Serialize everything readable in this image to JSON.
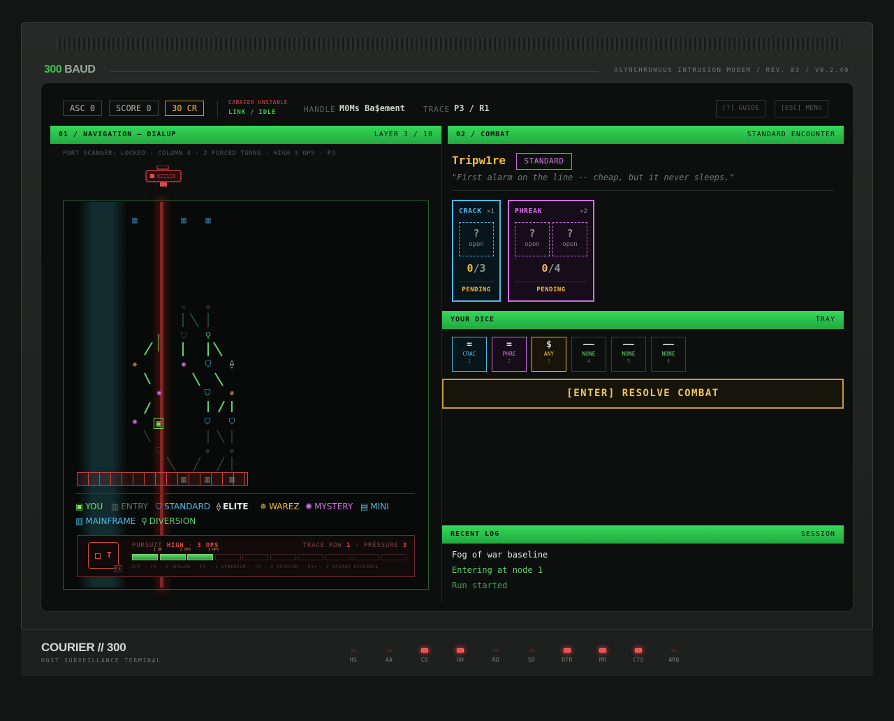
{
  "device": {
    "brand_num": "300",
    "brand_word": "BAUD",
    "subtitle": "ASYNCHRONOUS INTRUSION MODEM / REV. 03 / V0.2.40",
    "bottom_brand": "COURIER // 300",
    "bottom_sub": "HOST SURVEILLANCE TERMINAL"
  },
  "topbar": {
    "asc": "ASC 0",
    "score": "SCORE 0",
    "credits": "30 CR",
    "carrier": "CARRIER UNSTABLE",
    "link": "LINK / IDLE",
    "handle_label": "HANDLE",
    "handle_value": "M0Ms Ba$ement",
    "trace_label": "TRACE",
    "trace_value": "P3 / R1",
    "guide": "[?] GUIDE",
    "menu": "[ESC] MENU"
  },
  "navigation": {
    "header": "01 / NAVIGATION — DIALUP",
    "layer": "LAYER 3 / 10",
    "scanner": "PORT SCANNER: LOCKED · COLUMN 4 · 2 FORCED TURNS · HIGH 3 OPS · P3",
    "legend": [
      {
        "icon": "▣",
        "label": "YOU",
        "color": "#7ee05a"
      },
      {
        "icon": "▥",
        "label": "ENTRY",
        "color": "#5f6b62"
      },
      {
        "icon": "⛉",
        "label": "STANDARD",
        "color": "#4fb8e8"
      },
      {
        "icon": "⟠",
        "label": "ELITE",
        "color": "#e6ece8"
      },
      {
        "icon": "✵",
        "label": "WAREZ",
        "color": "#f0bc44"
      },
      {
        "icon": "✺",
        "label": "MYSTERY",
        "color": "#d070e8"
      },
      {
        "icon": "▤",
        "label": "MINI",
        "color": "#4fb8e8"
      },
      {
        "icon": "▥",
        "label": "MAINFRAME",
        "color": "#4fb8e8"
      },
      {
        "icon": "⚲",
        "label": "DIVERSION",
        "color": "#5fd070"
      }
    ],
    "pursuit": {
      "label": "PURSUIT",
      "level": "HIGH",
      "ops": "3 OPS",
      "trace_row_label": "TRACE ROW",
      "trace_row": "1",
      "pressure_label": "PRESSURE",
      "pressure": "3",
      "filled_segments": 3,
      "total_segments": 10,
      "seg_tags": [
        "1 OP",
        "2 OPS",
        "3 OPS"
      ],
      "icon_letter": "T",
      "icon_tag": "P3",
      "footer": "OFF · F0 · 0 OPSLOW · P1 · 1 OPMEDIUM · P2 · 2 OPSHIGH · P3+ · 3 OPSMAX RESPONSE"
    }
  },
  "combat": {
    "header": "02 / COMBAT",
    "encounter": "STANDARD ENCOUNTER",
    "enemy_name": "Tripw1re",
    "enemy_type": "STANDARD",
    "quote": "\"First alarm on the line -- cheap, but it never sleeps.\"",
    "cards": [
      {
        "name": "CRACK",
        "mult": "×1",
        "progress": "0",
        "total": "/3",
        "status": "PENDING",
        "slot_q": "?",
        "slot_label": "open",
        "color": "#4fb8e8"
      },
      {
        "name": "PHREAK",
        "mult": "×2",
        "progress": "0",
        "total": "/4",
        "status": "PENDING",
        "slot_q": "?",
        "slot_label": "open",
        "color": "#d070e8"
      }
    ]
  },
  "dice": {
    "header": "YOUR DICE",
    "tray": "TRAY",
    "items": [
      {
        "glyph": "=",
        "name": "CRAC",
        "index": "1",
        "color": "#4fb8e8"
      },
      {
        "glyph": "=",
        "name": "PHRE",
        "index": "2",
        "color": "#d070e8"
      },
      {
        "glyph": "$",
        "name": "ANY",
        "index": "3",
        "color": "#f0bc44"
      },
      {
        "glyph": "——",
        "name": "NONE",
        "index": "4",
        "color": "#5fd070"
      },
      {
        "glyph": "——",
        "name": "NONE",
        "index": "5",
        "color": "#5fd070"
      },
      {
        "glyph": "——",
        "name": "NONE",
        "index": "6",
        "color": "#5fd070"
      }
    ]
  },
  "resolve_button": "[ENTER] RESOLVE COMBAT",
  "log": {
    "header": "RECENT LOG",
    "session": "SESSION",
    "entries": [
      "Fog of war baseline",
      "Entering at node 1",
      "Run started"
    ]
  },
  "leds": [
    {
      "label": "HS",
      "on": false
    },
    {
      "label": "AA",
      "on": false
    },
    {
      "label": "CD",
      "on": true
    },
    {
      "label": "OH",
      "on": true
    },
    {
      "label": "RD",
      "on": false
    },
    {
      "label": "SD",
      "on": false
    },
    {
      "label": "DTR",
      "on": true
    },
    {
      "label": "MR",
      "on": true
    },
    {
      "label": "CTS",
      "on": true
    },
    {
      "label": "ARQ",
      "on": false
    }
  ]
}
